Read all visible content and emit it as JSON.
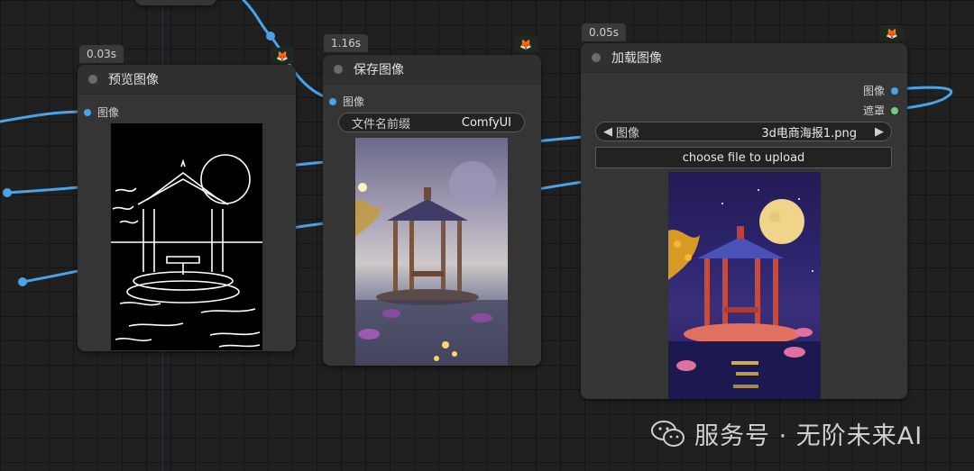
{
  "nodes": {
    "preview": {
      "time": "0.03s",
      "title": "预览图像",
      "input_label": "图像"
    },
    "save": {
      "time": "1.16s",
      "title": "保存图像",
      "input_label": "图像",
      "prefix_label": "文件名前缀",
      "prefix_value": "ComfyUI"
    },
    "load": {
      "time": "0.05s",
      "title": "加载图像",
      "output_image": "图像",
      "output_mask": "遮罩",
      "image_label": "图像",
      "image_value": "3d电商海报1.png",
      "upload_label": "choose file to upload",
      "prev_arrow": "◀",
      "next_arrow": "▶"
    }
  },
  "watermark": {
    "text": "服务号 · 无阶未来AI",
    "icon": "wechat-icon"
  },
  "colors": {
    "link_blue": "#4aa3e8",
    "image_slot": "#4aa3e8",
    "mask_slot": "#6fcf8a",
    "node_bg": "#353535",
    "canvas_bg": "#202020"
  },
  "icons": {
    "node_badge": "fox-icon",
    "collapse_dot": "collapse-dot-icon"
  }
}
